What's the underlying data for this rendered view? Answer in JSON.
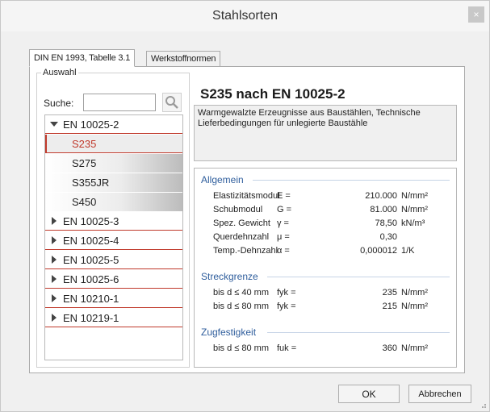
{
  "window": {
    "title": "Stahlsorten",
    "close_glyph": "×"
  },
  "tabs": [
    {
      "label": "DIN EN 1993, Tabelle 3.1",
      "active": true
    },
    {
      "label": "Werkstoffnormen",
      "active": false
    }
  ],
  "selection": {
    "group_label": "Auswahl",
    "search_label": "Suche:",
    "search_value": "",
    "search_icon": "magnifier-icon"
  },
  "tree": {
    "nodes": [
      {
        "label": "EN 10025-2",
        "expanded": true,
        "children": [
          "S235",
          "S275",
          "S355JR",
          "S450"
        ],
        "selected_child": 0
      },
      {
        "label": "EN 10025-3",
        "expanded": false
      },
      {
        "label": "EN 10025-4",
        "expanded": false
      },
      {
        "label": "EN 10025-5",
        "expanded": false
      },
      {
        "label": "EN 10025-6",
        "expanded": false
      },
      {
        "label": "EN 10210-1",
        "expanded": false
      },
      {
        "label": "EN 10219-1",
        "expanded": false
      }
    ]
  },
  "detail": {
    "heading": "S235 nach EN 10025-2",
    "description": "Warmgewalzte Erzeugnisse aus Baustählen, Technische Lieferbedingungen für unlegierte Baustähle"
  },
  "properties": {
    "allgemein": {
      "title": "Allgemein",
      "rows": [
        {
          "name": "Elastizitätsmodul",
          "symbol": "E =",
          "value": "210.000",
          "unit": "N/mm²"
        },
        {
          "name": "Schubmodul",
          "symbol": "G =",
          "value": "81.000",
          "unit": "N/mm²"
        },
        {
          "name": "Spez. Gewicht",
          "symbol": "γ =",
          "value": "78,50",
          "unit": "kN/m³"
        },
        {
          "name": "Querdehnzahl",
          "symbol": "μ =",
          "value": "0,30",
          "unit": ""
        },
        {
          "name": "Temp.-Dehnzahl",
          "symbol": "α =",
          "value": "0,000012",
          "unit": "1/K"
        }
      ]
    },
    "streckgrenze": {
      "title": "Streckgrenze",
      "rows": [
        {
          "name": "bis d ≤ 40 mm",
          "symbol": "fyk =",
          "value": "235",
          "unit": "N/mm²"
        },
        {
          "name": "bis d ≤ 80 mm",
          "symbol": "fyk =",
          "value": "215",
          "unit": "N/mm²"
        }
      ]
    },
    "zugfestigkeit": {
      "title": "Zugfestigkeit",
      "rows": [
        {
          "name": "bis d ≤ 80 mm",
          "symbol": "fuk =",
          "value": "360",
          "unit": "N/mm²"
        }
      ]
    }
  },
  "buttons": {
    "ok": "OK",
    "cancel": "Abbrechen"
  },
  "colors": {
    "accent_red": "#c0392b",
    "section_blue": "#2e5d9c"
  }
}
